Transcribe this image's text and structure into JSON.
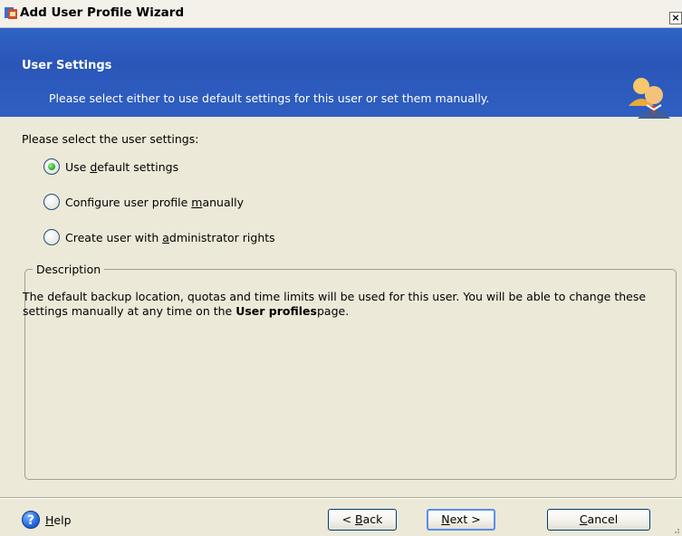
{
  "window": {
    "title": "Add User Profile Wizard",
    "close_label": "×"
  },
  "header": {
    "title": "User Settings",
    "subtitle": "Please select either to use default settings for this user or set them manually."
  },
  "content": {
    "prompt": "Please select the user settings:",
    "options": [
      {
        "pre": "Use ",
        "accel": "d",
        "post": "efault settings",
        "checked": true
      },
      {
        "pre": "Configure user profile ",
        "accel": "m",
        "post": "anually",
        "checked": false
      },
      {
        "pre": "Create user with ",
        "accel": "a",
        "post": "dministrator rights",
        "checked": false
      }
    ]
  },
  "description": {
    "legend": "Description",
    "text_before": "The default backup location, quotas and time limits will be used for this user. You will be able to change these settings manually at any time on the ",
    "bold": "User profiles",
    "text_after": "page."
  },
  "footer": {
    "help": {
      "icon": "?",
      "accel": "H",
      "rest": "elp"
    },
    "back": {
      "pre": "< ",
      "accel": "B",
      "post": "ack"
    },
    "next": {
      "pre": "",
      "accel": "N",
      "post": "ext >"
    },
    "cancel": {
      "pre": "",
      "accel": "C",
      "post": "ancel"
    }
  },
  "colors": {
    "header_blue": "#2e63c6",
    "window_bg": "#ece9d8",
    "radio_checked": "#2bb52b"
  }
}
